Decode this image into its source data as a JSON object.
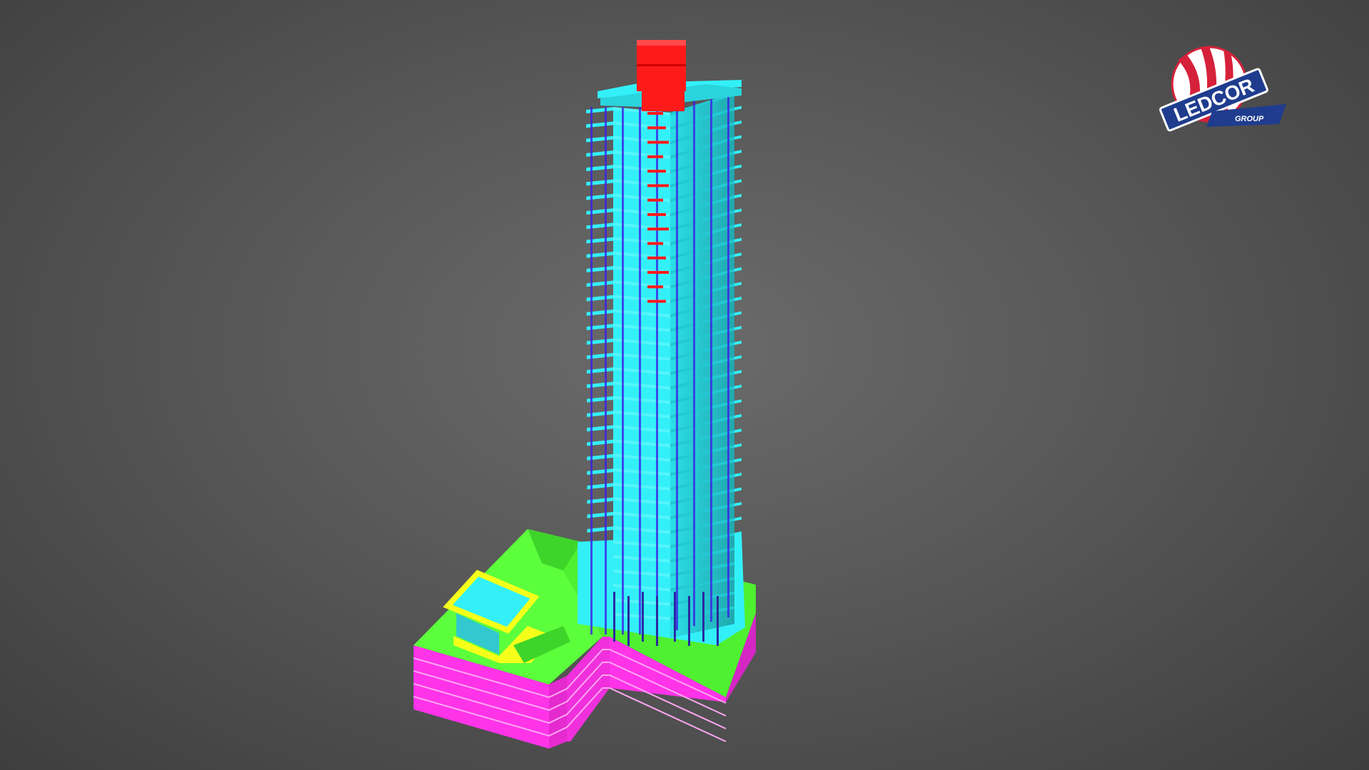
{
  "scene": {
    "subject": "building-model",
    "colors": {
      "background_center": "#6b6b6b",
      "background_edge": "#3e3e3e",
      "tower_slabs": "#33f0f8",
      "tower_columns": "#3a22e8",
      "core": "#ff1a1a",
      "podium_roof": "#5cff3c",
      "parkade": "#ff33e8",
      "amenity_frame": "#f5ff1a"
    },
    "tower": {
      "floor_count": 36
    },
    "parkade": {
      "level_count": 4
    }
  },
  "logo": {
    "text": "LEDCOR",
    "subtext": "GROUP",
    "colors": {
      "red": "#d6213a",
      "navy": "#1f3c8e",
      "white": "#ffffff"
    }
  }
}
